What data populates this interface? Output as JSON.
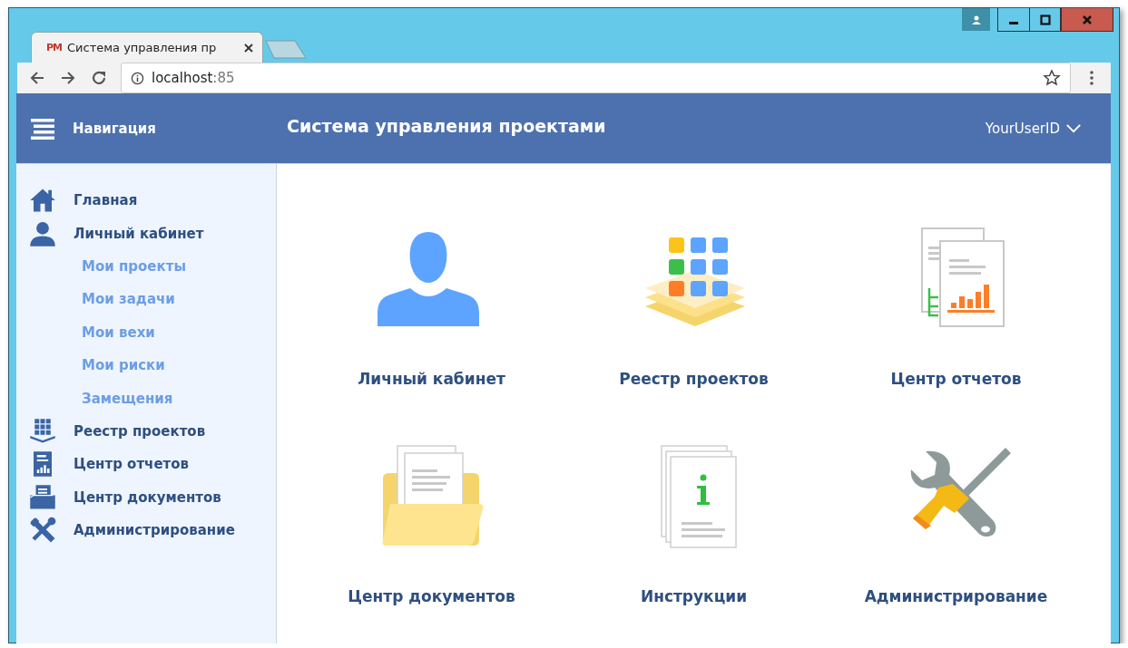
{
  "window": {
    "controls": [
      {
        "kind": "user"
      },
      {
        "kind": "minimize"
      },
      {
        "kind": "maximize"
      },
      {
        "kind": "close"
      }
    ]
  },
  "tabs": [
    {
      "favicon_text": "PM",
      "title": "Система управления пр",
      "selected": true
    },
    {
      "kind": "new",
      "selected": false
    }
  ],
  "address_bar": {
    "host": "localhost",
    "port": ":85"
  },
  "header": {
    "nav_label": "Навигация",
    "title": "Система управления проектами",
    "user": "YourUserID"
  },
  "sidebar": {
    "items": [
      {
        "label": "Главная",
        "kind": "home"
      },
      {
        "label": "Личный кабинет",
        "kind": "user",
        "expanded": true,
        "children": [
          {
            "label": "Мои проекты"
          },
          {
            "label": "Мои задачи"
          },
          {
            "label": "Мои вехи"
          },
          {
            "label": "Мои риски"
          },
          {
            "label": "Замещения"
          }
        ]
      },
      {
        "label": "Реестр проектов",
        "kind": "registry"
      },
      {
        "label": "Центр отчетов",
        "kind": "reports"
      },
      {
        "label": "Центр документов",
        "kind": "documents"
      },
      {
        "label": "Администрирование",
        "kind": "admin"
      }
    ]
  },
  "tiles": [
    {
      "label": "Личный кабинет",
      "kind": "user"
    },
    {
      "label": "Реестр проектов",
      "kind": "registry"
    },
    {
      "label": "Центр отчетов",
      "kind": "reports"
    },
    {
      "label": "Центр документов",
      "kind": "documents"
    },
    {
      "label": "Инструкции",
      "kind": "instructions"
    },
    {
      "label": "Администрирование",
      "kind": "admin"
    }
  ]
}
